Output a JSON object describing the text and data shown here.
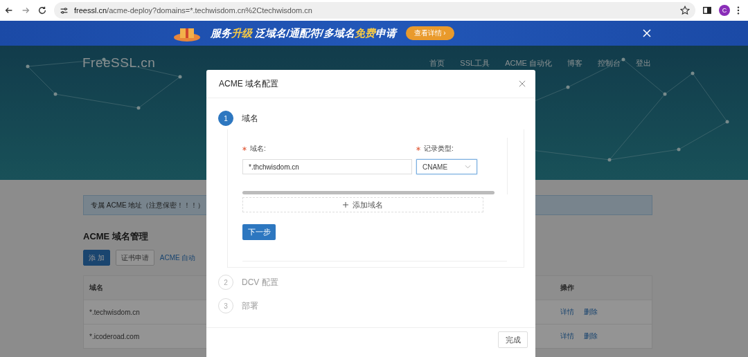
{
  "browser": {
    "url_host": "freessl.cn",
    "url_path": "/acme-deploy?domains=*.techwisdom.cn%2Ctechwisdom.cn",
    "avatar": "C"
  },
  "banner": {
    "parts": [
      {
        "text": "服务",
        "highlight": false
      },
      {
        "text": "升级",
        "highlight": true
      },
      {
        "text": " 泛域名/通配符/多域名",
        "highlight": false
      },
      {
        "text": "免费",
        "highlight": true
      },
      {
        "text": "申请",
        "highlight": false
      }
    ],
    "button": "查看详情 ›"
  },
  "site": {
    "logo": "FreeSSL.cn",
    "nav": [
      "首页",
      "SSL工具",
      "ACME 自动化",
      "博客",
      "控制台",
      "登出"
    ]
  },
  "page": {
    "notice": "专属 ACME 地址（注意保密！！！）",
    "heading": "ACME 域名管理",
    "buttons": [
      {
        "label": "添 加",
        "kind": "primary"
      },
      {
        "label": "证书申请",
        "kind": "default"
      },
      {
        "label": "ACME 自动",
        "kind": "link"
      }
    ],
    "table": {
      "columns": [
        "域名",
        "操作"
      ],
      "rows": [
        {
          "domain": "*.techwisdom.cn",
          "actions": [
            "详情",
            "删除"
          ]
        },
        {
          "domain": "*.icoderoad.com",
          "actions": [
            "详情",
            "删除"
          ]
        }
      ]
    }
  },
  "dialog": {
    "title": "ACME 域名配置",
    "steps": [
      {
        "number": "1",
        "label": "域名",
        "selected": true
      },
      {
        "number": "2",
        "label": "DCV 配置",
        "selected": false
      },
      {
        "number": "3",
        "label": "部署",
        "selected": false
      }
    ],
    "fields": [
      {
        "label": "域名:",
        "required": true,
        "value": "*.thchwisdom.cn",
        "kind": "input"
      },
      {
        "label": "记录类型:",
        "required": true,
        "value": "CNAME",
        "kind": "select"
      }
    ],
    "add_button": "添加域名",
    "next_button": "下一步",
    "finish_button": "完成"
  }
}
